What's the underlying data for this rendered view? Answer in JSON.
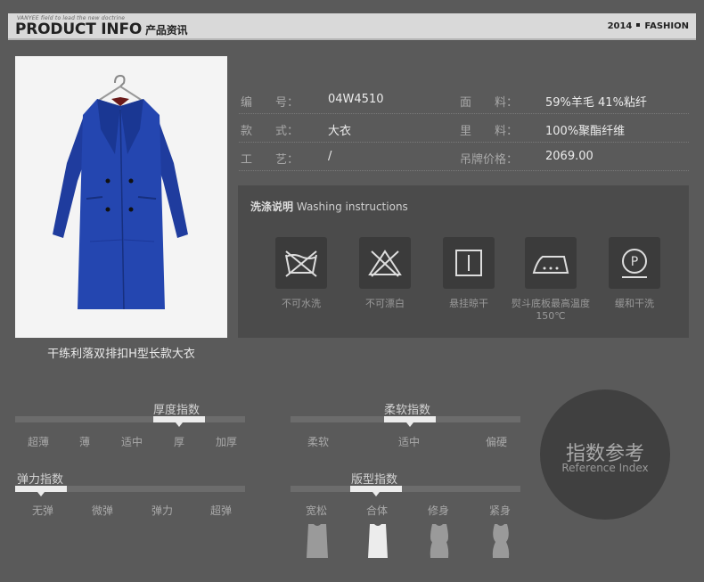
{
  "header": {
    "tagline": "VANYEE field to lead the new doctrine",
    "title_en": "PRODUCT INFO",
    "title_zh": "产品资讯",
    "year": "2014",
    "fashion": "FASHION"
  },
  "product": {
    "caption": "干练利落双排扣H型长款大衣",
    "rows": [
      {
        "l1": "编　　号：",
        "v1": "04W4510",
        "l2": "面　　料：",
        "v2": "59%羊毛 41%粘纤"
      },
      {
        "l1": "款　　式：",
        "v1": "大衣",
        "l2": "里　　料：",
        "v2": "100%聚酯纤维"
      },
      {
        "l1": "工　　艺：",
        "v1": "/",
        "l2": "吊牌价格：",
        "v2": "2069.00"
      }
    ]
  },
  "washing": {
    "title_zh": "洗涤说明",
    "title_en": "Washing instructions",
    "items": [
      {
        "icon": "no-wash-icon",
        "label": "不可水洗"
      },
      {
        "icon": "no-bleach-icon",
        "label": "不可漂白"
      },
      {
        "icon": "hang-dry-icon",
        "label": "悬挂晾干"
      },
      {
        "icon": "iron-icon",
        "label": "熨斗底板最高温度150℃"
      },
      {
        "icon": "dry-clean-icon",
        "label": "缓和干洗"
      }
    ]
  },
  "reference": {
    "title_zh": "指数参考",
    "title_en": "Reference Index",
    "thickness": {
      "title": "厚度指数",
      "options": [
        "超薄",
        "薄",
        "适中",
        "厚",
        "加厚"
      ],
      "selected": 3
    },
    "softness": {
      "title": "柔软指数",
      "options": [
        "柔软",
        "适中",
        "偏硬"
      ],
      "selected": 1
    },
    "elasticity": {
      "title": "弹力指数",
      "options": [
        "无弹",
        "微弹",
        "弹力",
        "超弹"
      ],
      "selected": 0
    },
    "fit": {
      "title": "版型指数",
      "options": [
        "宽松",
        "合体",
        "修身",
        "紧身"
      ],
      "selected": 1
    }
  }
}
